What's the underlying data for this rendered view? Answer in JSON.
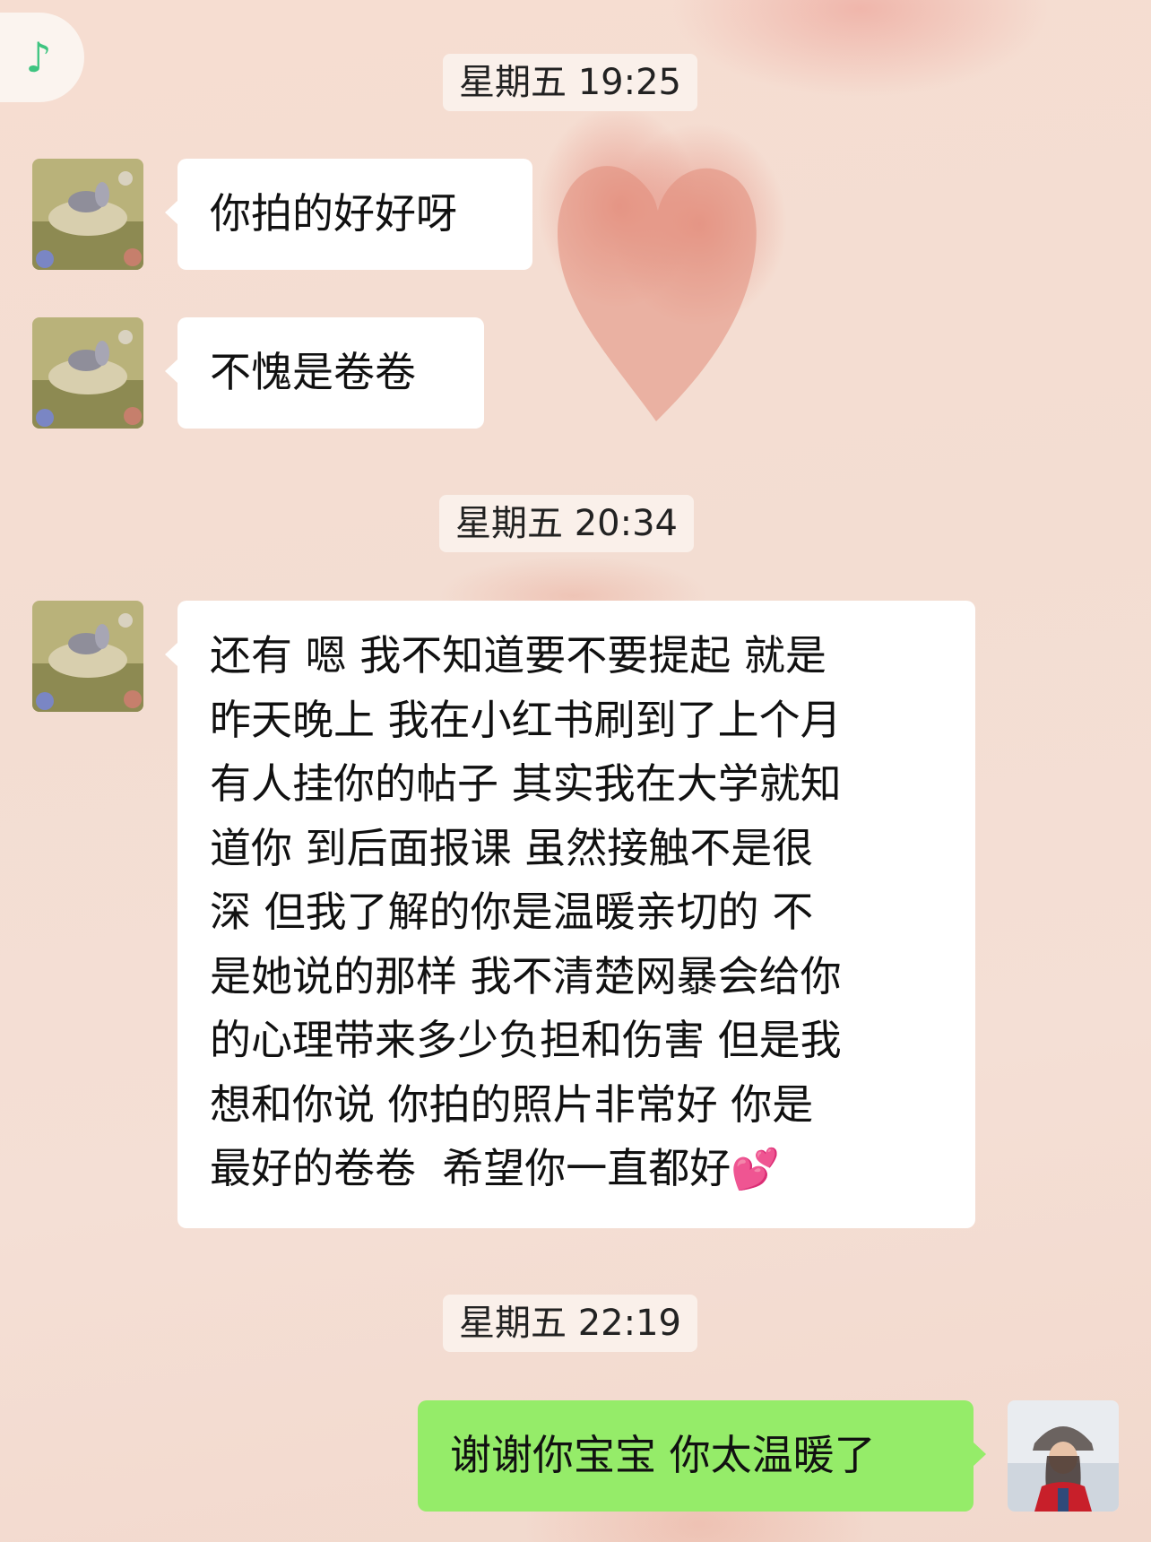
{
  "music_indicator": {
    "icon": "music-note-icon",
    "glyph": "♪",
    "color": "#3ec480"
  },
  "messages": [
    {
      "type": "timestamp",
      "text": "星期五 19:25"
    },
    {
      "type": "received",
      "sender_avatar": "cartoon-rabbit-avatar",
      "text": "你拍的好好呀"
    },
    {
      "type": "received",
      "sender_avatar": "cartoon-rabbit-avatar",
      "text": "不愧是卷卷"
    },
    {
      "type": "timestamp",
      "text": "星期五 20:34"
    },
    {
      "type": "received",
      "sender_avatar": "cartoon-rabbit-avatar",
      "lines": [
        "还有 嗯 我不知道要不要提起 就是",
        "昨天晚上 我在小红书刷到了上个月",
        "有人挂你的帖子 其实我在大学就知",
        "道你 到后面报课 虽然接触不是很",
        "深 但我了解的你是温暖亲切的 不",
        "是她说的那样 我不清楚网暴会给你",
        "的心理带来多少负担和伤害 但是我",
        "想和你说 你拍的照片非常好 你是",
        "最好的卷卷  希望你一直都好"
      ],
      "emoji": "💕"
    },
    {
      "type": "timestamp",
      "text": "星期五 22:19"
    },
    {
      "type": "sent",
      "sender_avatar": "user-photo-avatar",
      "text": "谢谢你宝宝 你太温暖了"
    }
  ],
  "colors": {
    "received_bubble": "#ffffff",
    "sent_bubble": "#95ec69",
    "timestamp_bg": "#faf3ee"
  }
}
